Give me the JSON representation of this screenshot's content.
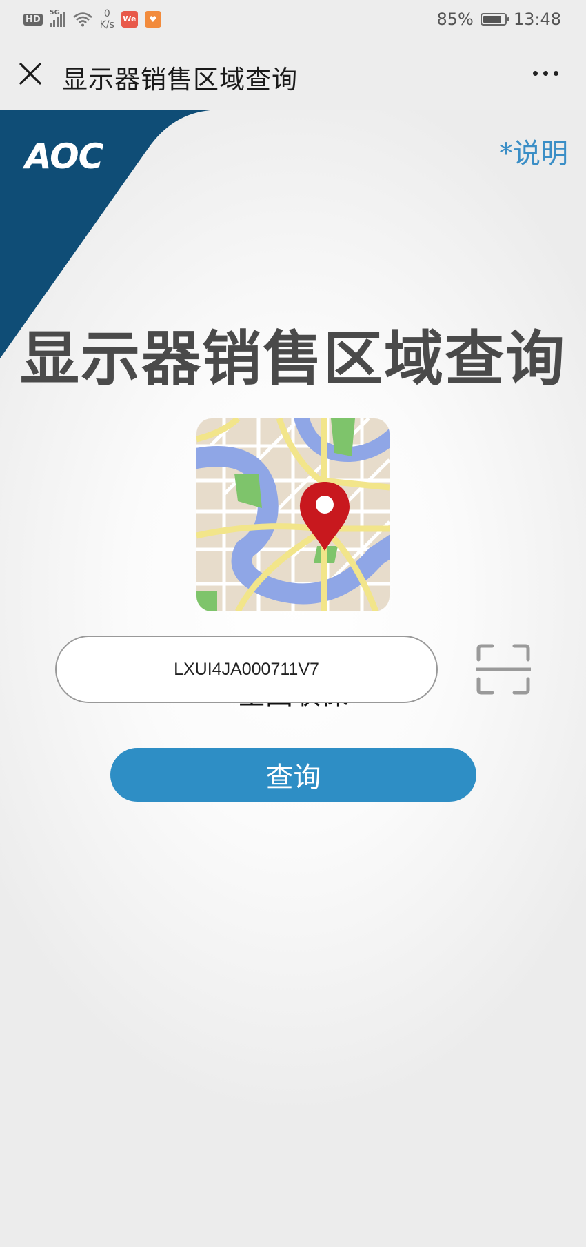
{
  "status_bar": {
    "hd": "HD",
    "network": "5G",
    "speed_value": "0",
    "speed_unit": "K/s",
    "app1": "We",
    "battery": "85%",
    "battery_level": 0.85,
    "time": "13:48"
  },
  "title_bar": {
    "title": "显示器销售区域查询",
    "close_icon": "close-icon",
    "more_icon": "more-icon"
  },
  "brand": {
    "logo": "AOC",
    "color": "#0f4d76"
  },
  "help_link": "*说明",
  "headline": "显示器销售区域查询",
  "subtitle": "全国联保",
  "serial_input": {
    "value": "LXUI4JA000711V7",
    "placeholder": ""
  },
  "scan_icon": "scan-icon",
  "query_button": "查询",
  "colors": {
    "accent": "#2e8ec5",
    "link": "#3a8ec6",
    "headline": "#4a4a4a"
  }
}
